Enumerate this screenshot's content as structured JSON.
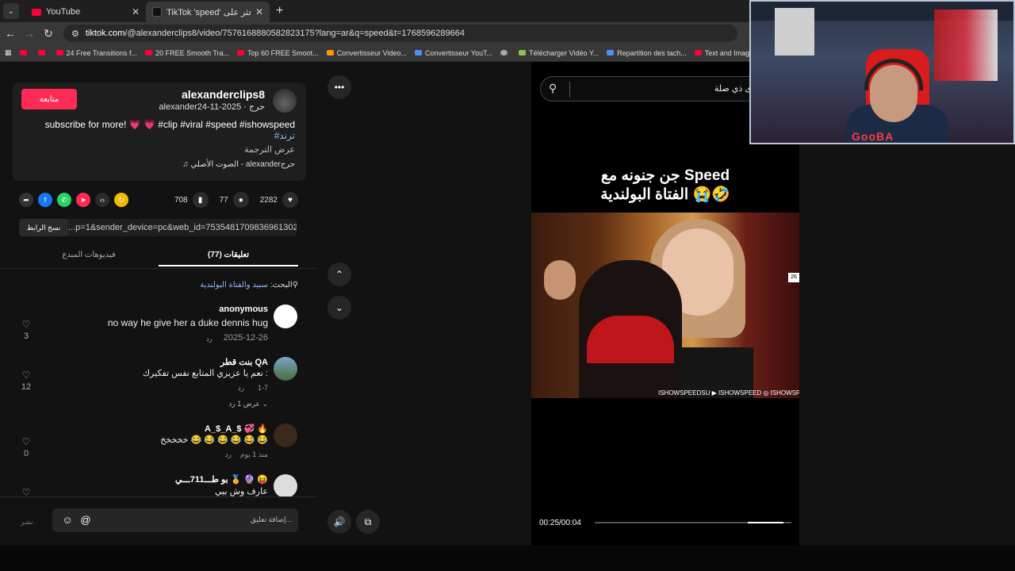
{
  "browser": {
    "tabs": [
      {
        "label": "YouTube"
      },
      {
        "label": "TikTok 'speed' اعثر على"
      }
    ],
    "url_prefix": "tiktok.com",
    "url_rest": "/@alexanderclips8/video/7576168880582823175?lang=ar&q=speed&t=1768596289664",
    "bookmarks": [
      {
        "label": ""
      },
      {
        "label": ""
      },
      {
        "label": "24 Free Transitions f..."
      },
      {
        "label": "20 FREE Smooth Tra..."
      },
      {
        "label": "Top 60 FREE Smoot..."
      },
      {
        "label": "Convertisseur Video..."
      },
      {
        "label": "Convertisseur YouT..."
      },
      {
        "label": ""
      },
      {
        "label": "Télécharger Vidéo Y..."
      },
      {
        "label": "Repartition des tach..."
      },
      {
        "label": "Text and Image ani..."
      },
      {
        "label": "Y"
      }
    ]
  },
  "post": {
    "follow_label": "متابعة",
    "author_name": "alexanderclips8",
    "author_sub": "alexanderحرج · 2025-11-24",
    "description": "subscribe for more! 💗 💗 #clip #viral #speed #ishowspeed",
    "hashtag_line": "#ترند",
    "see_translation": "عرض الترجمة",
    "sound": "♫ الصوت الأصلي - alexanderحرج",
    "likes": "2282",
    "comments": "77",
    "saves": "708",
    "copy_label": "نسخ الرابط",
    "link": "...p=1&sender_device=pc&web_id=7535481709836961302",
    "tab_comments": "تعليقات (77)",
    "tab_creator": "فيديوهات المبدع",
    "search_prefix": "البحث: ",
    "search_query": "سبيد والفتاة البولندية"
  },
  "comments": [
    {
      "name": "anonymous",
      "text": "no way he give her a duke dennis hug",
      "date": "2025-12-26",
      "reply": "رد",
      "likes": "3"
    },
    {
      "name": "بنت قطر QA",
      "text": "نعم يا عزيزي المتابع نفس تفكيرك :",
      "date": "1-7",
      "reply": "رد",
      "likes": "12",
      "view_replies": "عرض 1 رد"
    },
    {
      "name": "A_$_A_$ 💞 🔥",
      "text": "خخخخخ 😂 😂 😂 😂 😂 😂",
      "date": "منذ 1 يوم",
      "reply": "رد",
      "likes": "0"
    },
    {
      "name": "بو طـــ711ـــي 🏅 🔮 😝",
      "text": "عارف وش بيي"
    }
  ],
  "comment_input": {
    "post_label": "نشر",
    "placeholder": "إضافة تعليق..."
  },
  "video": {
    "search_placeholder": "محتوى ذي صلة",
    "caption_line1": "جن جنونه مع Speed",
    "caption_line2": "الفتاة البولندية 😭🤣",
    "watermark": "ISHOWSPEEDSU ▶ ISHOWSPEED ◎ ISHOWSPEED",
    "badge": "26",
    "time": "00:25/00:04",
    "progress": 0.18
  },
  "webcam": {
    "logo": "GooBA"
  }
}
